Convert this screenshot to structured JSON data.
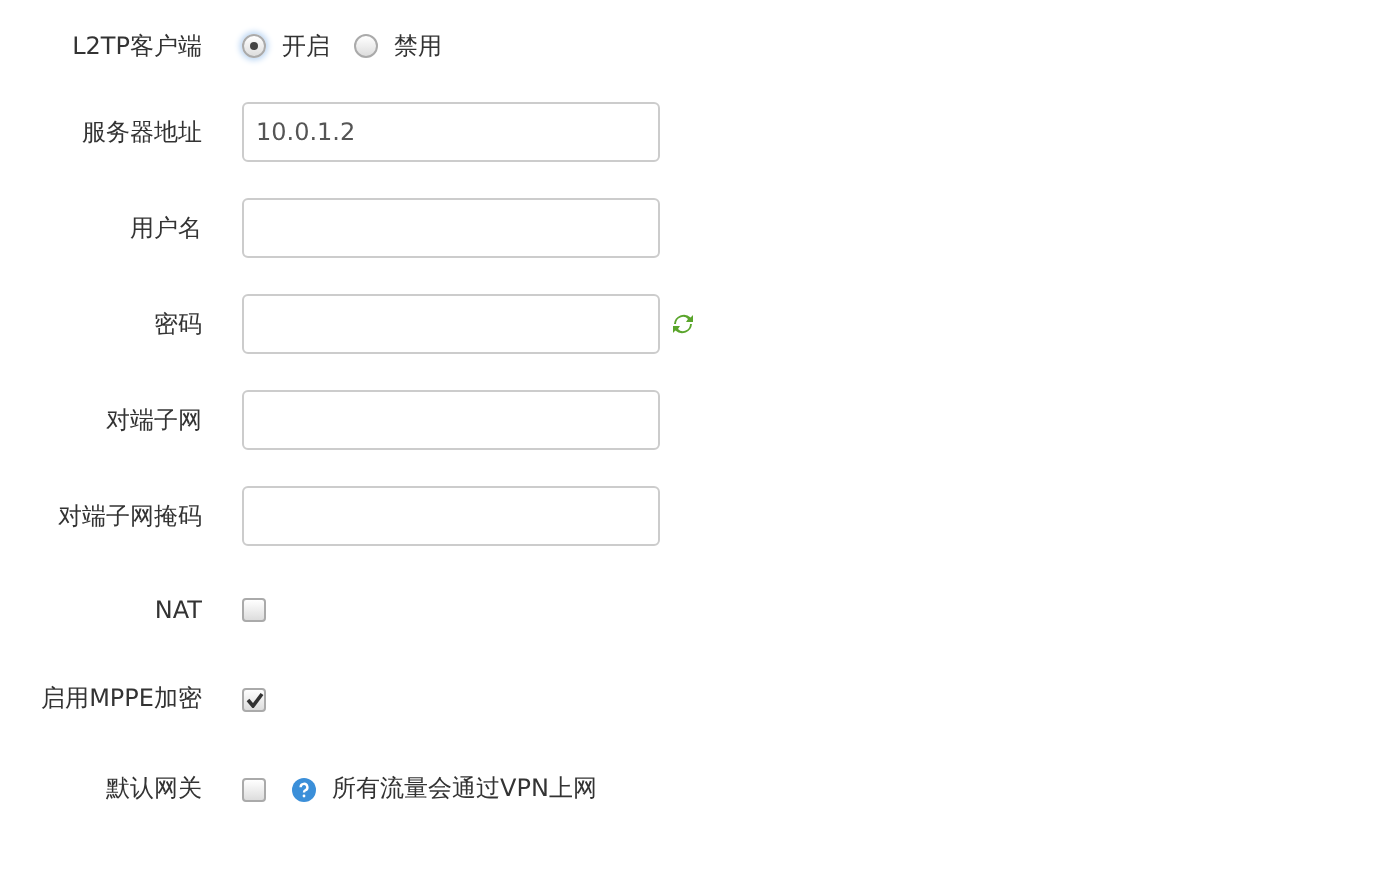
{
  "rows": [
    {
      "kind": "radio",
      "label": "L2TP客户端",
      "options": [
        {
          "label": "开启",
          "selected": true
        },
        {
          "label": "禁用",
          "selected": false
        }
      ]
    },
    {
      "kind": "text",
      "label": "服务器地址",
      "value": "10.0.1.2"
    },
    {
      "kind": "text",
      "label": "用户名"
    },
    {
      "kind": "password",
      "label": "密码"
    },
    {
      "kind": "text",
      "label": "对端子网"
    },
    {
      "kind": "text",
      "label": "对端子网掩码"
    },
    {
      "kind": "checkbox",
      "label": "NAT",
      "checked": false
    },
    {
      "kind": "checkbox",
      "label": "启用MPPE加密",
      "checked": true
    },
    {
      "kind": "checkbox",
      "label": "默认网关",
      "checked": false,
      "hint": "所有流量会通过VPN上网"
    }
  ]
}
